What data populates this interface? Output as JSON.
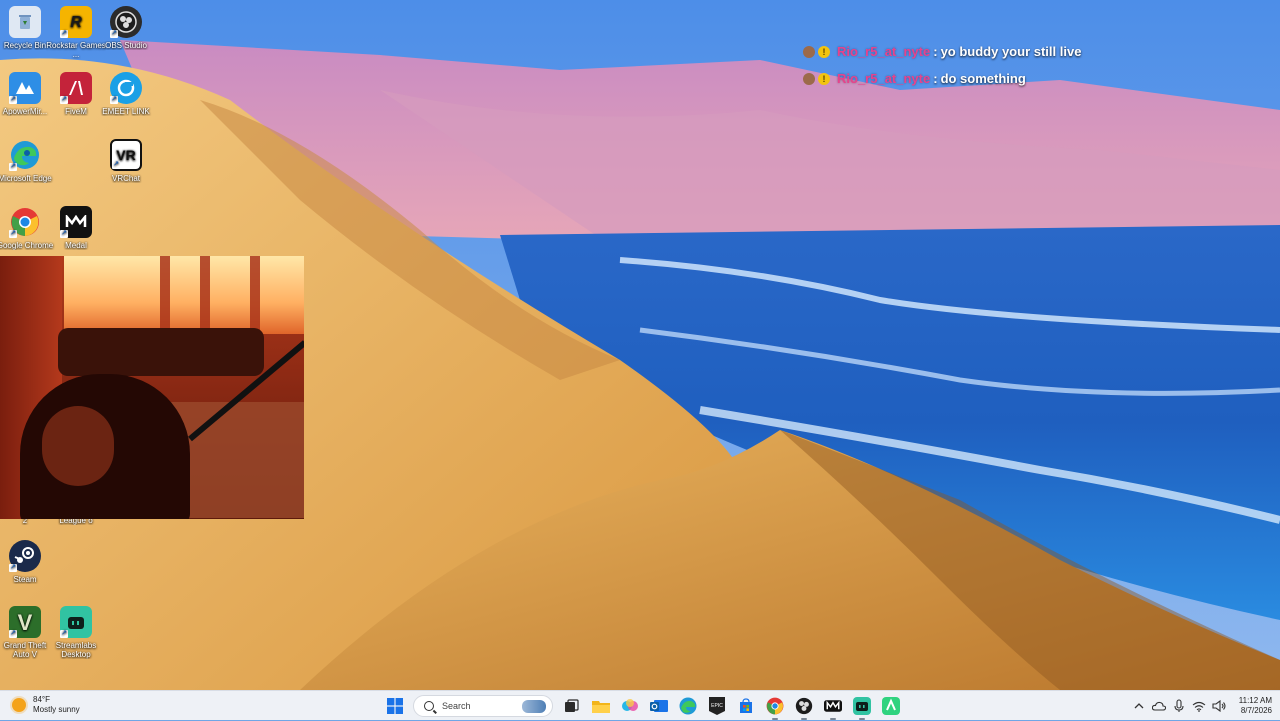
{
  "desktop": {
    "icons": [
      {
        "label": "Recycle Bin"
      },
      {
        "label": "Rockstar Games ..."
      },
      {
        "label": "OBS Studio"
      },
      {
        "label": "ApowerMir..."
      },
      {
        "label": "FiveM"
      },
      {
        "label": "EMEET LINK"
      },
      {
        "label": "Microsoft Edge"
      },
      {
        "label": "VRChat"
      },
      {
        "label": "Google Chrome"
      },
      {
        "label": "Medal"
      },
      {
        "label": "2"
      },
      {
        "label": "League o"
      },
      {
        "label": "Steam"
      },
      {
        "label": "Grand Theft Auto V"
      },
      {
        "label": "Streamlabs Desktop"
      }
    ]
  },
  "chat": {
    "messages": [
      {
        "user": "Rio_r5_at_nyte",
        "separator": ":",
        "text": "yo buddy your still live"
      },
      {
        "user": "Rio_r5_at_nyte",
        "separator": ":",
        "text": "do something"
      }
    ],
    "name_color": "#e8428c"
  },
  "taskbar": {
    "weather": {
      "temp": "84°F",
      "condition": "Mostly sunny"
    },
    "search": {
      "placeholder": "Search"
    },
    "clock": {
      "time": "11:12 AM",
      "date": "8/7/2026"
    },
    "apps": [
      "windows-start",
      "search",
      "task-view",
      "file-explorer",
      "copilot",
      "outlook",
      "edge",
      "epic-games",
      "microsoft-store",
      "chrome",
      "obs",
      "medal",
      "streamlabs",
      "app-green"
    ],
    "tray_icons": [
      "chevron-up",
      "cloud",
      "microphone",
      "wifi",
      "speaker"
    ]
  }
}
